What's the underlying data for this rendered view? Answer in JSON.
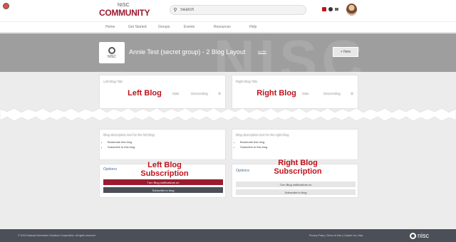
{
  "header": {
    "brand_top": "NISC",
    "brand_main": "COMMUNITY",
    "search_value": "Search",
    "nav_items": [
      "Home",
      "Get Started",
      "Groups",
      "Events",
      "Resources",
      "Help"
    ]
  },
  "hero": {
    "logo_text": "NISC",
    "watermark": "NISC",
    "title": "Annie Test (secret group) - 2 Blog Layout",
    "more": "MORE",
    "new_button": "+ New"
  },
  "left_blog": {
    "blurred_title": "Left Blog Title",
    "sort_option": "Date",
    "sort_order": "Descending",
    "label": "Left Blog",
    "desc": "Blog description text for the left blog.",
    "list": [
      "Bookmark this blog.",
      "Subscribe to this blog."
    ],
    "sub_label_line1": "Left Blog",
    "sub_label_line2": "Subscription",
    "options_title": "Options",
    "btn1": "Turn Blog notifications on",
    "btn2": "Subscribe to blog"
  },
  "right_blog": {
    "blurred_title": "Right Blog Title",
    "sort_option": "Date",
    "sort_order": "Descending",
    "label": "Right Blog",
    "desc": "Blog description text for the right blog.",
    "list": [
      "Bookmark this blog.",
      "Subscribe to this blog."
    ],
    "sub_label_line1": "Right Blog",
    "sub_label_line2": "Subscription",
    "options_title": "Options",
    "btn1": "Turn Blog notifications on",
    "btn2": "Subscribe to blog"
  },
  "footer": {
    "copyright": "© 2024 National Information Solutions Cooperative. All rights reserved.",
    "links": "Privacy Policy | Terms of Use | Contact Us | Help",
    "logo": "nisc"
  },
  "colors": {
    "brand": "#9b1b30",
    "label_red": "#c0121a",
    "hero_bg": "#9e9e9e",
    "footer_bg": "#4b4f58"
  }
}
